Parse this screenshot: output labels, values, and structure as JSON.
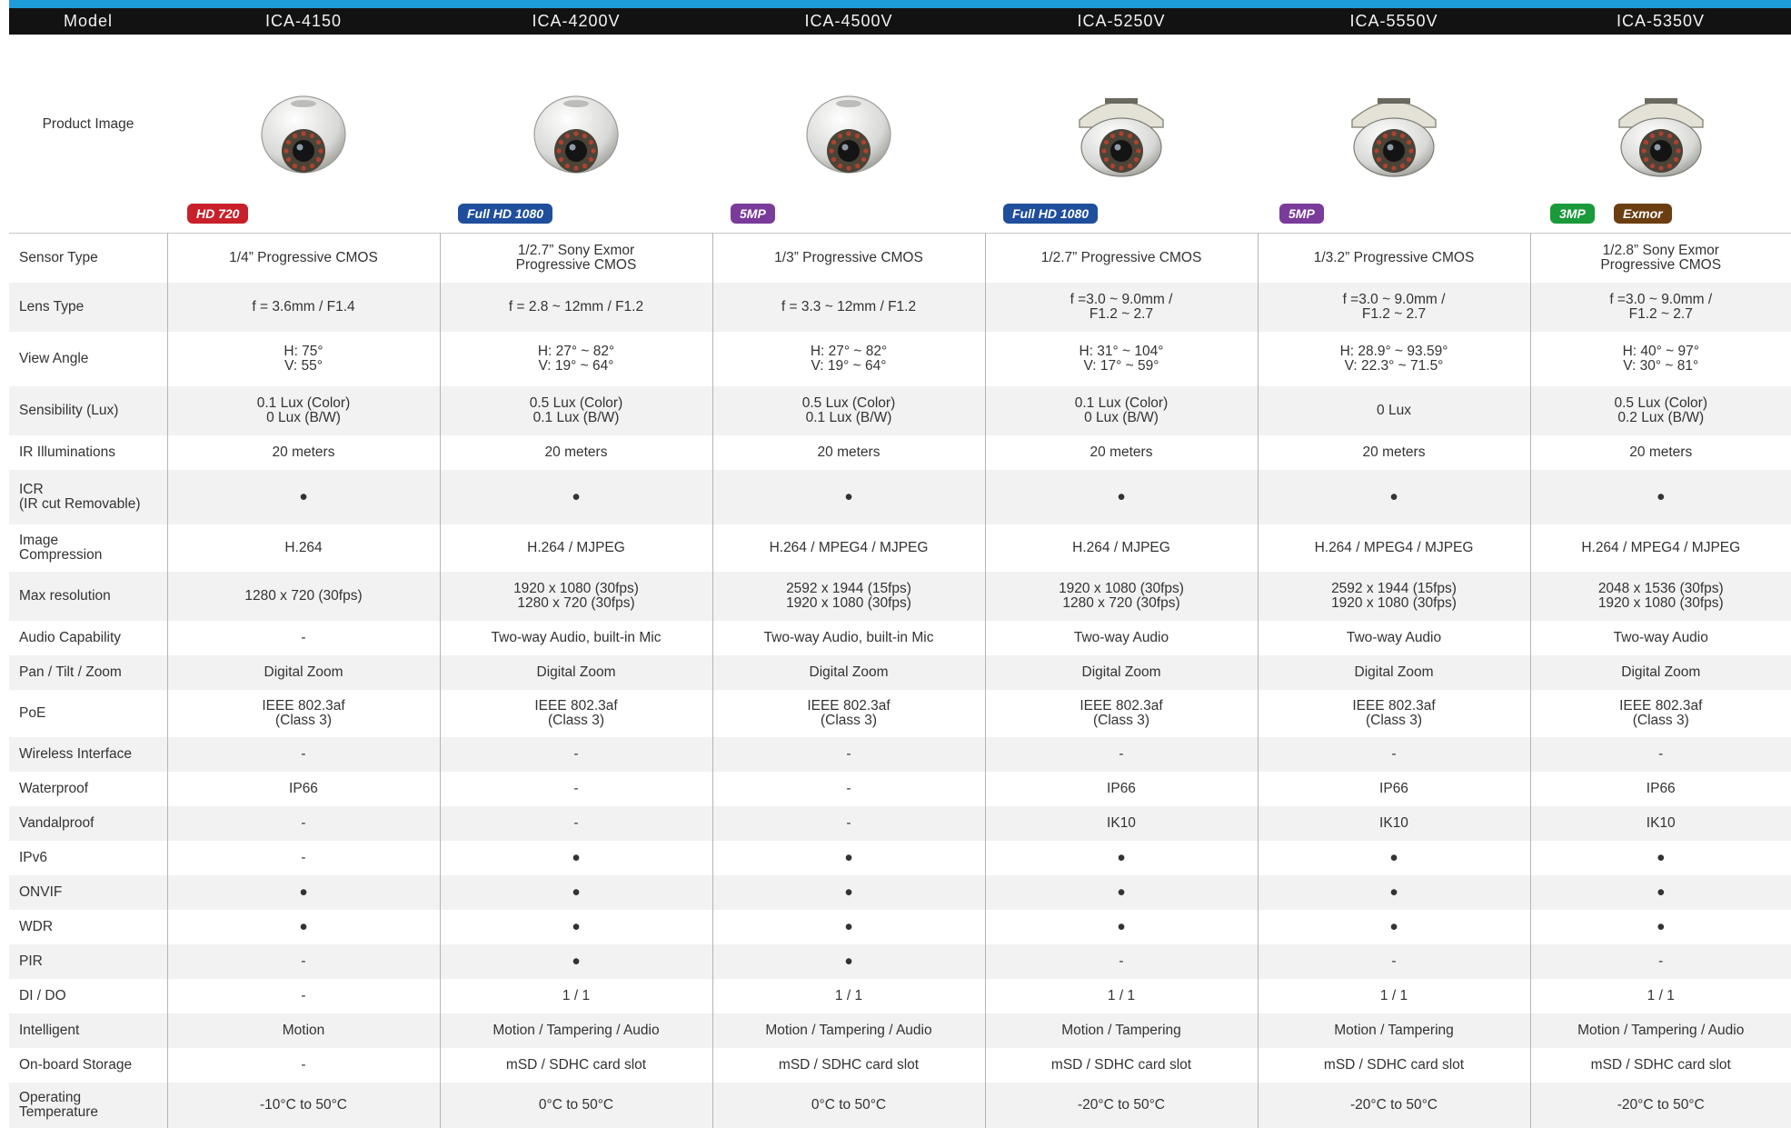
{
  "header": {
    "label": "Model",
    "models": [
      "ICA-4150",
      "ICA-4200V",
      "ICA-4500V",
      "ICA-5250V",
      "ICA-5550V",
      "ICA-5350V"
    ]
  },
  "image_row": {
    "label": "Product Image",
    "badges": [
      [
        {
          "text": "HD 720",
          "color": "#c8202a"
        }
      ],
      [
        {
          "text": "Full HD 1080",
          "color": "#1f4e9c"
        }
      ],
      [
        {
          "text": "5MP",
          "color": "#7a3b9b"
        }
      ],
      [
        {
          "text": "Full HD 1080",
          "color": "#1f4e9c"
        }
      ],
      [
        {
          "text": "5MP",
          "color": "#7a3b9b"
        }
      ],
      [
        {
          "text": "3MP",
          "color": "#1a9a3a"
        },
        {
          "text": "Exmor",
          "color": "#6b3e12"
        }
      ]
    ]
  },
  "rows": [
    {
      "label": "Sensor Type",
      "values": [
        "1/4” Progressive  CMOS",
        "1/2.7” Sony Exmor\nProgressive CMOS",
        "1/3” Progressive CMOS",
        "1/2.7” Progressive CMOS",
        "1/3.2” Progressive CMOS",
        "1/2.8” Sony Exmor\nProgressive CMOS"
      ]
    },
    {
      "label": "Lens Type",
      "values": [
        "f = 3.6mm / F1.4",
        "f = 2.8 ~ 12mm / F1.2",
        "f = 3.3 ~ 12mm / F1.2",
        "f =3.0 ~ 9.0mm /\nF1.2 ~ 2.7",
        "f =3.0 ~ 9.0mm /\nF1.2 ~ 2.7",
        "f =3.0 ~ 9.0mm /\nF1.2 ~ 2.7"
      ]
    },
    {
      "label": "View Angle",
      "values": [
        "H: 75°\nV: 55°",
        "H: 27° ~ 82°\nV: 19° ~ 64°",
        "H: 27° ~ 82°\nV: 19° ~ 64°",
        "H: 31° ~ 104°\nV: 17° ~ 59°",
        "H: 28.9° ~ 93.59°\nV: 22.3° ~ 71.5°",
        "H: 40° ~ 97°\nV: 30° ~ 81°"
      ]
    },
    {
      "label": "Sensibility (Lux)",
      "values": [
        "0.1 Lux (Color)\n0 Lux (B/W)",
        "0.5 Lux (Color)\n0.1 Lux (B/W)",
        "0.5 Lux (Color)\n0.1 Lux (B/W)",
        "0.1 Lux (Color)\n0 Lux (B/W)",
        "0 Lux",
        "0.5 Lux (Color)\n0.2 Lux (B/W)"
      ]
    },
    {
      "label": "IR Illuminations",
      "values": [
        "20 meters",
        "20 meters",
        "20 meters",
        "20 meters",
        "20 meters",
        "20 meters"
      ]
    },
    {
      "label": "ICR\n(IR cut Removable)",
      "values": [
        "●",
        "●",
        "●",
        "●",
        "●",
        "●"
      ]
    },
    {
      "label": "Image\nCompression",
      "values": [
        "H.264",
        "H.264 / MJPEG",
        "H.264 / MPEG4 / MJPEG",
        "H.264 / MJPEG",
        "H.264 / MPEG4 / MJPEG",
        "H.264 / MPEG4 / MJPEG"
      ]
    },
    {
      "label": "Max resolution",
      "values": [
        "1280 x 720 (30fps)",
        "1920 x 1080 (30fps)\n1280 x 720 (30fps)",
        "2592 x 1944 (15fps)\n1920 x 1080 (30fps)",
        "1920 x 1080 (30fps)\n1280 x 720 (30fps)",
        "2592 x 1944 (15fps)\n1920 x 1080 (30fps)",
        "2048 x 1536 (30fps)\n1920 x 1080 (30fps)"
      ]
    },
    {
      "label": "Audio Capability",
      "values": [
        "-",
        "Two-way Audio, built-in Mic",
        "Two-way Audio, built-in Mic",
        "Two-way Audio",
        "Two-way Audio",
        "Two-way Audio"
      ]
    },
    {
      "label": "Pan / Tilt / Zoom",
      "values": [
        "Digital Zoom",
        "Digital Zoom",
        "Digital Zoom",
        "Digital Zoom",
        "Digital Zoom",
        "Digital Zoom"
      ]
    },
    {
      "label": "PoE",
      "values": [
        "IEEE 802.3af\n(Class 3)",
        "IEEE 802.3af\n(Class 3)",
        "IEEE 802.3af\n(Class 3)",
        "IEEE 802.3af\n(Class 3)",
        "IEEE 802.3af\n(Class 3)",
        "IEEE 802.3af\n(Class 3)"
      ]
    },
    {
      "label": "Wireless Interface",
      "values": [
        "-",
        "-",
        "-",
        "-",
        "-",
        "-"
      ]
    },
    {
      "label": "Waterproof",
      "values": [
        "IP66",
        "-",
        "-",
        "IP66",
        "IP66",
        "IP66"
      ]
    },
    {
      "label": "Vandalproof",
      "values": [
        "-",
        "-",
        "-",
        "IK10",
        "IK10",
        "IK10"
      ]
    },
    {
      "label": "IPv6",
      "values": [
        "-",
        "●",
        "●",
        "●",
        "●",
        "●"
      ]
    },
    {
      "label": "ONVIF",
      "values": [
        "●",
        "●",
        "●",
        "●",
        "●",
        "●"
      ]
    },
    {
      "label": "WDR",
      "values": [
        "●",
        "●",
        "●",
        "●",
        "●",
        "●"
      ]
    },
    {
      "label": "PIR",
      "values": [
        "-",
        "●",
        "●",
        "-",
        "-",
        "-"
      ]
    },
    {
      "label": "DI / DO",
      "values": [
        "-",
        "1 / 1",
        "1 / 1",
        "1 / 1",
        "1 / 1",
        "1 / 1"
      ]
    },
    {
      "label": "Intelligent",
      "values": [
        "Motion",
        "Motion / Tampering / Audio",
        "Motion / Tampering / Audio",
        "Motion / Tampering",
        "Motion / Tampering",
        "Motion / Tampering / Audio"
      ]
    },
    {
      "label": "On-board Storage",
      "values": [
        "-",
        "mSD / SDHC card slot",
        "mSD / SDHC card slot",
        "mSD / SDHC card slot",
        "mSD / SDHC card slot",
        "mSD / SDHC card slot"
      ]
    },
    {
      "label": "Operating\nTemperature",
      "values": [
        "-10°C to 50°C",
        "0°C to 50°C",
        "0°C to 50°C",
        "-20°C to 50°C",
        "-20°C to 50°C",
        "-20°C to 50°C"
      ]
    }
  ]
}
